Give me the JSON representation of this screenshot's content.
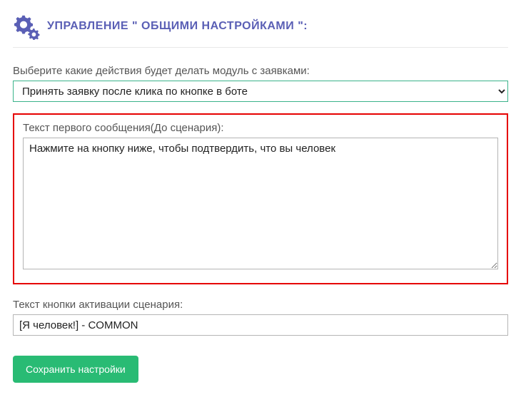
{
  "header": {
    "title": "УПРАВЛЕНИЕ \" ОБЩИМИ НАСТРОЙКАМИ \":"
  },
  "form": {
    "action_label": "Выберите какие действия будет делать модуль с заявками:",
    "action_selected": "Принять заявку после клика по кнопке в боте",
    "first_message_label": "Текст первого сообщения(До сценария):",
    "first_message_value": "Нажмите на кнопку ниже, чтобы подтвердить, что вы человек",
    "button_text_label": "Текст кнопки активации сценария:",
    "button_text_value": "[Я человек!] - COMMON",
    "save_label": "Сохранить настройки"
  }
}
